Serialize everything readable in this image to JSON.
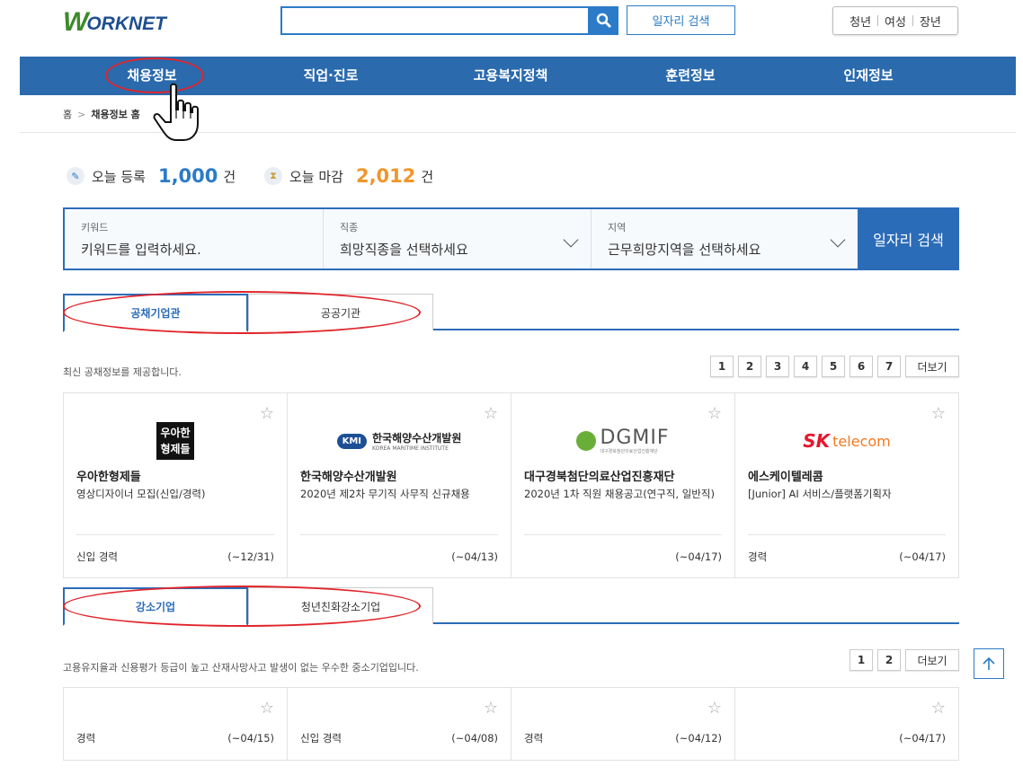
{
  "header": {
    "logo_w": "W",
    "logo_rest": "ORKNET",
    "search_placeholder": "",
    "job_search_label": "일자리 검색",
    "user_tabs": [
      "청년",
      "여성",
      "장년"
    ]
  },
  "nav": [
    "채용정보",
    "직업·진로",
    "고용복지정책",
    "훈련정보",
    "인재정보"
  ],
  "breadcrumb": [
    "홈",
    "채용정보 홈"
  ],
  "today": {
    "registered_label": "오늘 등록",
    "registered_value": "1,000",
    "closing_label": "오늘 마감",
    "closing_value": "2,012",
    "unit": "건"
  },
  "filter": {
    "keyword_label": "키워드",
    "keyword_placeholder": "키워드를 입력하세요.",
    "job_label": "직종",
    "job_value": "희망직종을 선택하세요",
    "region_label": "지역",
    "region_value": "근무희망지역을 선택하세요",
    "button": "일자리 검색"
  },
  "public": {
    "tabs": [
      "공채기업관",
      "공공기관"
    ],
    "desc": "최신 공채정보를 제공합니다.",
    "pages": [
      "1",
      "2",
      "3",
      "4",
      "5",
      "6",
      "7"
    ],
    "more": "더보기",
    "cards": [
      {
        "logo": "우아한\n형제들",
        "name": "우아한형제들",
        "title": "영상디자이너 모집(신입/경력)",
        "type": "신입 경력",
        "deadline": "(~12/31)"
      },
      {
        "logo_badge": "KMI",
        "logo_text": "한국해양수산개발원",
        "logo_sub": "KOREA MARITIME INSTITUTE",
        "name": "한국해양수산개발원",
        "title": "2020년 제2차 무기직 사무직 신규채용",
        "type": "",
        "deadline": "(~04/13)"
      },
      {
        "logo_text": "DGMIF",
        "logo_sub": "대구경북첨단의료산업진흥재단",
        "name": "대구경북첨단의료산업진흥재단",
        "title": "2020년 1차 직원 채용공고(연구직, 일반직)",
        "type": "",
        "deadline": "(~04/17)"
      },
      {
        "logo_sk": "SK",
        "logo_text": "telecom",
        "name": "에스케이텔레콤",
        "title": "[Junior] AI 서비스/플랫폼기획자",
        "type": "경력",
        "deadline": "(~04/17)"
      }
    ]
  },
  "small": {
    "tabs": [
      "강소기업",
      "청년친화강소기업"
    ],
    "desc": "고용유지율과 신용평가 등급이 높고 산재사망사고 발생이 없는 우수한 중소기업입니다.",
    "pages": [
      "1",
      "2"
    ],
    "more": "더보기",
    "cards": [
      {
        "type": "경력",
        "deadline": "(~04/15)"
      },
      {
        "type": "신입 경력",
        "deadline": "(~04/08)"
      },
      {
        "type": "경력",
        "deadline": "(~04/12)"
      },
      {
        "type": "",
        "deadline": "(~04/17)"
      }
    ]
  },
  "colors": {
    "brand_blue": "#2a6aad",
    "highlight_red": "#e0252b",
    "orange": "#f0962b"
  }
}
